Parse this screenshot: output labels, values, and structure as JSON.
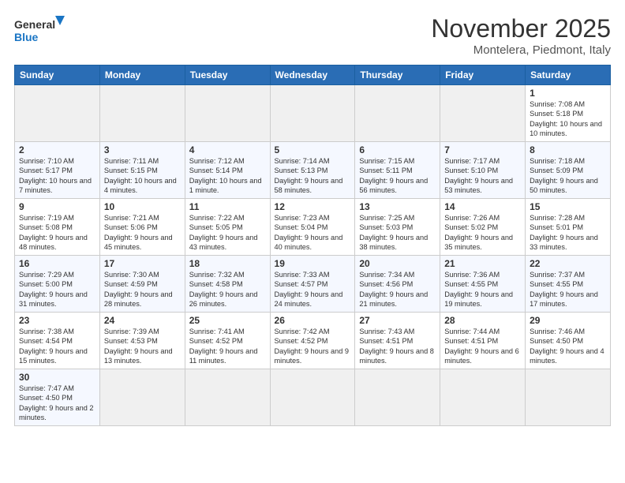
{
  "header": {
    "logo_general": "General",
    "logo_blue": "Blue",
    "month": "November 2025",
    "location": "Montelera, Piedmont, Italy"
  },
  "weekdays": [
    "Sunday",
    "Monday",
    "Tuesday",
    "Wednesday",
    "Thursday",
    "Friday",
    "Saturday"
  ],
  "weeks": [
    [
      {
        "day": "",
        "info": ""
      },
      {
        "day": "",
        "info": ""
      },
      {
        "day": "",
        "info": ""
      },
      {
        "day": "",
        "info": ""
      },
      {
        "day": "",
        "info": ""
      },
      {
        "day": "",
        "info": ""
      },
      {
        "day": "1",
        "info": "Sunrise: 7:08 AM\nSunset: 5:18 PM\nDaylight: 10 hours and 10 minutes."
      }
    ],
    [
      {
        "day": "2",
        "info": "Sunrise: 7:10 AM\nSunset: 5:17 PM\nDaylight: 10 hours and 7 minutes."
      },
      {
        "day": "3",
        "info": "Sunrise: 7:11 AM\nSunset: 5:15 PM\nDaylight: 10 hours and 4 minutes."
      },
      {
        "day": "4",
        "info": "Sunrise: 7:12 AM\nSunset: 5:14 PM\nDaylight: 10 hours and 1 minute."
      },
      {
        "day": "5",
        "info": "Sunrise: 7:14 AM\nSunset: 5:13 PM\nDaylight: 9 hours and 58 minutes."
      },
      {
        "day": "6",
        "info": "Sunrise: 7:15 AM\nSunset: 5:11 PM\nDaylight: 9 hours and 56 minutes."
      },
      {
        "day": "7",
        "info": "Sunrise: 7:17 AM\nSunset: 5:10 PM\nDaylight: 9 hours and 53 minutes."
      },
      {
        "day": "8",
        "info": "Sunrise: 7:18 AM\nSunset: 5:09 PM\nDaylight: 9 hours and 50 minutes."
      }
    ],
    [
      {
        "day": "9",
        "info": "Sunrise: 7:19 AM\nSunset: 5:08 PM\nDaylight: 9 hours and 48 minutes."
      },
      {
        "day": "10",
        "info": "Sunrise: 7:21 AM\nSunset: 5:06 PM\nDaylight: 9 hours and 45 minutes."
      },
      {
        "day": "11",
        "info": "Sunrise: 7:22 AM\nSunset: 5:05 PM\nDaylight: 9 hours and 43 minutes."
      },
      {
        "day": "12",
        "info": "Sunrise: 7:23 AM\nSunset: 5:04 PM\nDaylight: 9 hours and 40 minutes."
      },
      {
        "day": "13",
        "info": "Sunrise: 7:25 AM\nSunset: 5:03 PM\nDaylight: 9 hours and 38 minutes."
      },
      {
        "day": "14",
        "info": "Sunrise: 7:26 AM\nSunset: 5:02 PM\nDaylight: 9 hours and 35 minutes."
      },
      {
        "day": "15",
        "info": "Sunrise: 7:28 AM\nSunset: 5:01 PM\nDaylight: 9 hours and 33 minutes."
      }
    ],
    [
      {
        "day": "16",
        "info": "Sunrise: 7:29 AM\nSunset: 5:00 PM\nDaylight: 9 hours and 31 minutes."
      },
      {
        "day": "17",
        "info": "Sunrise: 7:30 AM\nSunset: 4:59 PM\nDaylight: 9 hours and 28 minutes."
      },
      {
        "day": "18",
        "info": "Sunrise: 7:32 AM\nSunset: 4:58 PM\nDaylight: 9 hours and 26 minutes."
      },
      {
        "day": "19",
        "info": "Sunrise: 7:33 AM\nSunset: 4:57 PM\nDaylight: 9 hours and 24 minutes."
      },
      {
        "day": "20",
        "info": "Sunrise: 7:34 AM\nSunset: 4:56 PM\nDaylight: 9 hours and 21 minutes."
      },
      {
        "day": "21",
        "info": "Sunrise: 7:36 AM\nSunset: 4:55 PM\nDaylight: 9 hours and 19 minutes."
      },
      {
        "day": "22",
        "info": "Sunrise: 7:37 AM\nSunset: 4:55 PM\nDaylight: 9 hours and 17 minutes."
      }
    ],
    [
      {
        "day": "23",
        "info": "Sunrise: 7:38 AM\nSunset: 4:54 PM\nDaylight: 9 hours and 15 minutes."
      },
      {
        "day": "24",
        "info": "Sunrise: 7:39 AM\nSunset: 4:53 PM\nDaylight: 9 hours and 13 minutes."
      },
      {
        "day": "25",
        "info": "Sunrise: 7:41 AM\nSunset: 4:52 PM\nDaylight: 9 hours and 11 minutes."
      },
      {
        "day": "26",
        "info": "Sunrise: 7:42 AM\nSunset: 4:52 PM\nDaylight: 9 hours and 9 minutes."
      },
      {
        "day": "27",
        "info": "Sunrise: 7:43 AM\nSunset: 4:51 PM\nDaylight: 9 hours and 8 minutes."
      },
      {
        "day": "28",
        "info": "Sunrise: 7:44 AM\nSunset: 4:51 PM\nDaylight: 9 hours and 6 minutes."
      },
      {
        "day": "29",
        "info": "Sunrise: 7:46 AM\nSunset: 4:50 PM\nDaylight: 9 hours and 4 minutes."
      }
    ],
    [
      {
        "day": "30",
        "info": "Sunrise: 7:47 AM\nSunset: 4:50 PM\nDaylight: 9 hours and 2 minutes."
      },
      {
        "day": "",
        "info": ""
      },
      {
        "day": "",
        "info": ""
      },
      {
        "day": "",
        "info": ""
      },
      {
        "day": "",
        "info": ""
      },
      {
        "day": "",
        "info": ""
      },
      {
        "day": "",
        "info": ""
      }
    ]
  ]
}
